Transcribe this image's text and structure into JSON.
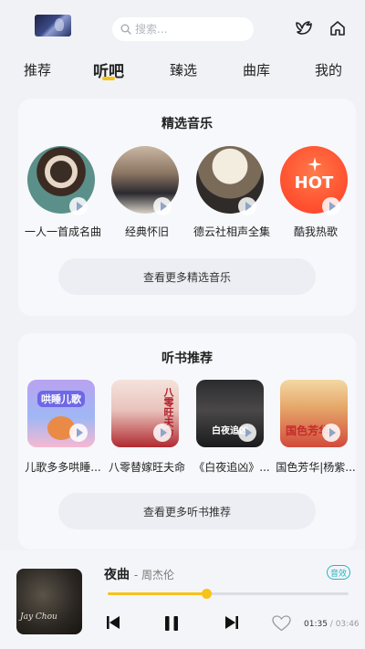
{
  "header": {
    "search_placeholder": "搜索...",
    "icons": [
      "avatar",
      "search-icon",
      "bird-icon",
      "home-icon"
    ]
  },
  "tabs": [
    {
      "label": "推荐",
      "active": false
    },
    {
      "label": "听吧",
      "active": true
    },
    {
      "label": "臻选",
      "active": false
    },
    {
      "label": "曲库",
      "active": false
    },
    {
      "label": "我的",
      "active": false
    }
  ],
  "music_section": {
    "title": "精选音乐",
    "items": [
      {
        "label": "一人一首成名曲"
      },
      {
        "label": "经典怀旧"
      },
      {
        "label": "德云社相声全集"
      },
      {
        "label": "酷我热歌",
        "badge_text": "HOT"
      }
    ],
    "more_label": "查看更多精选音乐"
  },
  "book_section": {
    "title": "听书推荐",
    "items": [
      {
        "label": "儿歌多多哄睡...",
        "cover_text": "哄睡儿歌"
      },
      {
        "label": "八零替嫁旺夫命",
        "cover_text": "八零旺夫命"
      },
      {
        "label": "《白夜追凶》...",
        "cover_text": "白夜追凶"
      },
      {
        "label": "国色芳华|杨紫...",
        "cover_text": "国色芳华"
      }
    ],
    "more_label": "查看更多听书推荐"
  },
  "player": {
    "song": "夜曲",
    "artist": "- 周杰伦",
    "effect_label": "音效",
    "cover_caption": "Jay Chou",
    "progress": 0.41,
    "current_time": "01:35",
    "separator": " / ",
    "total_time": "03:46"
  },
  "colors": {
    "accent": "#f8c318",
    "effect": "#2bb3c0",
    "background": "#f1f2f6",
    "card": "#f7f8fb"
  }
}
